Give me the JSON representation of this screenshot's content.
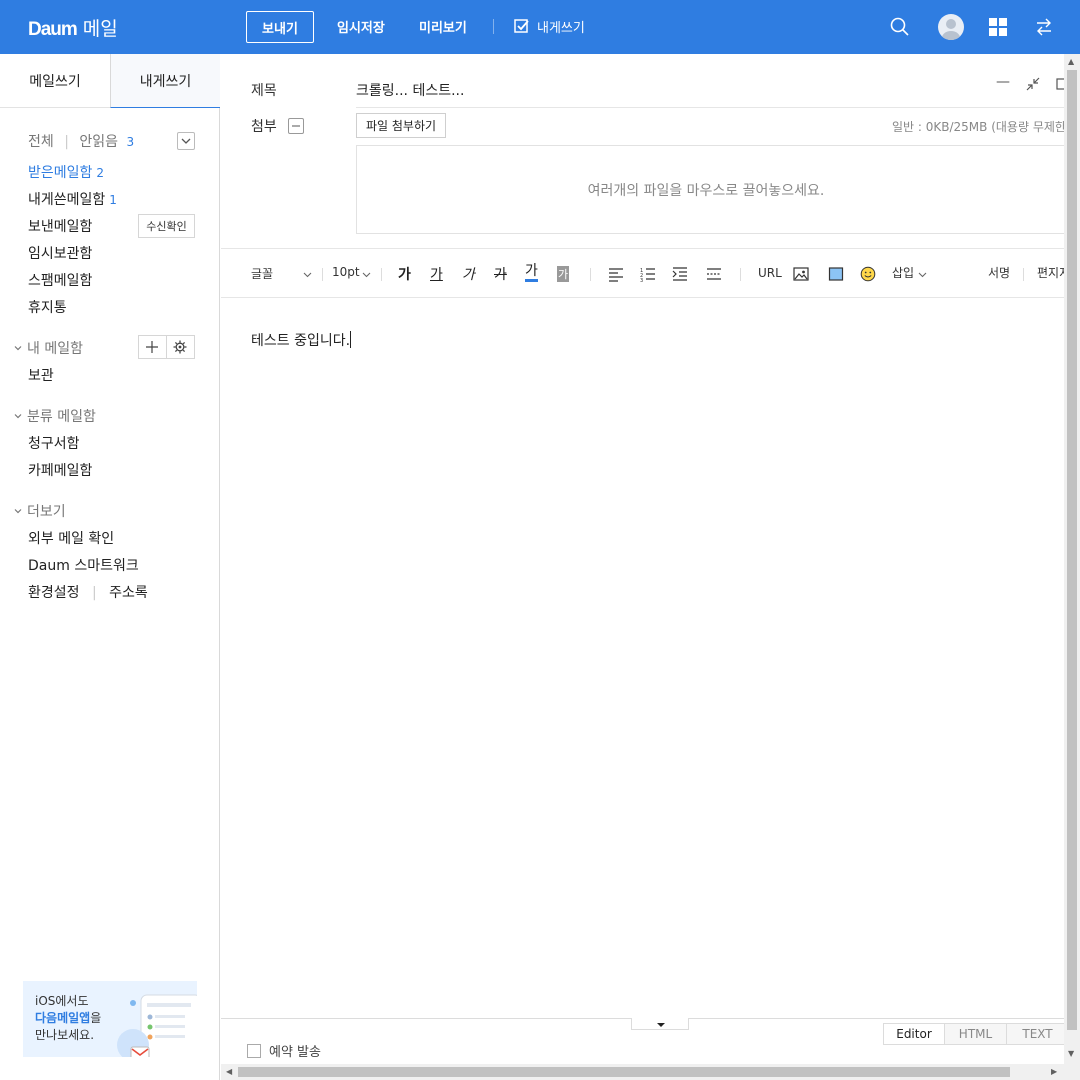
{
  "header": {
    "logo_brand": "Daum",
    "logo_service": "메일",
    "send_label": "보내기",
    "save_draft_label": "임시저장",
    "preview_label": "미리보기",
    "self_write_label": "내게쓰기"
  },
  "sidebar": {
    "tabs": [
      "메일쓰기",
      "내게쓰기"
    ],
    "filter_all": "전체",
    "filter_unread": "안읽음",
    "unread_count": "3",
    "folders": [
      {
        "label": "받은메일함",
        "count": "2"
      },
      {
        "label": "내게쓴메일함",
        "count": "1"
      },
      {
        "label": "보낸메일함",
        "count": ""
      },
      {
        "label": "임시보관함",
        "count": ""
      },
      {
        "label": "스팸메일함",
        "count": ""
      },
      {
        "label": "휴지통",
        "count": ""
      }
    ],
    "receipt_check_label": "수신확인",
    "my_mailbox_title": "내 메일함",
    "my_mailbox_items": [
      "보관"
    ],
    "category_title": "분류 메일함",
    "category_items": [
      "청구서함",
      "카페메일함"
    ],
    "more_title": "더보기",
    "more_items": [
      "외부 메일 확인",
      "Daum 스마트워크"
    ],
    "settings_label": "환경설정",
    "addressbook_label": "주소록",
    "promo": {
      "line1": "iOS에서도",
      "line2_strong": "다음메일앱",
      "line2_rest": "을",
      "line3": "만나보세요."
    }
  },
  "compose": {
    "subject_label": "제목",
    "subject_value": "크롤링... 테스트...",
    "attach_label": "첨부",
    "attach_button": "파일 첨부하기",
    "quota_text": "일반 : 0KB/25MB (대용량 무제한",
    "dropzone_text": "여러개의 파일을 마우스로 끌어놓으세요.",
    "body_text": "테스트 중입니다."
  },
  "toolbar": {
    "font_label": "글꼴",
    "size_label": "10pt",
    "bold_glyph": "가",
    "underline_glyph": "가",
    "italic_glyph": "가",
    "strike_glyph": "가",
    "fontcolor_glyph": "가",
    "bgcolor_glyph": "가",
    "url_label": "URL",
    "insert_label": "삽입",
    "signature_label": "서명",
    "stationery_label": "편지지"
  },
  "footer": {
    "schedule_label": "예약 발송",
    "modes": [
      "Editor",
      "HTML",
      "TEXT"
    ]
  },
  "colors": {
    "accent": "#2f7de1",
    "topbar": "#2f7de1"
  }
}
